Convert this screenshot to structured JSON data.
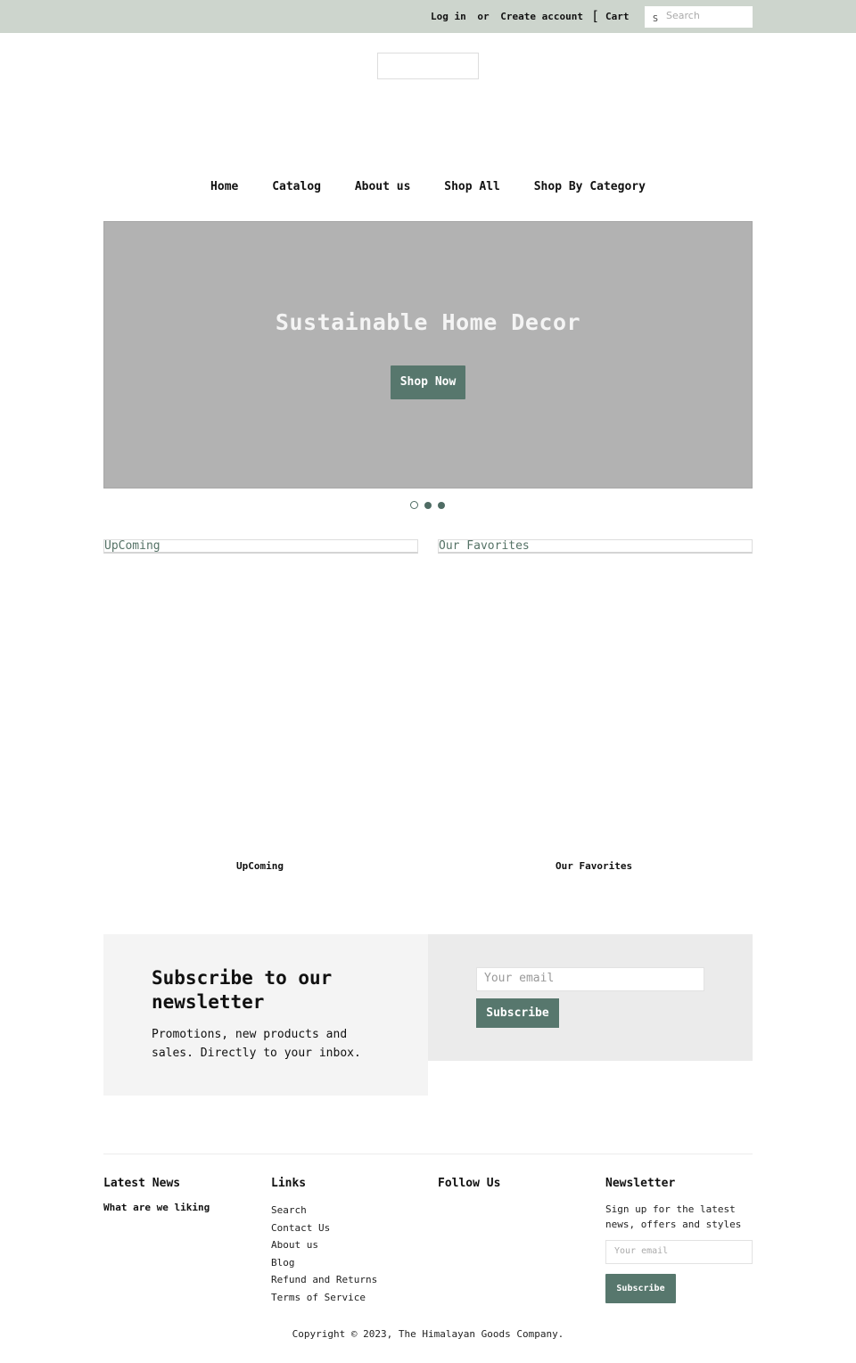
{
  "topbar": {
    "login": "Log in",
    "or": "or",
    "create_account": "Create account",
    "cart_icon": "[",
    "cart": "Cart",
    "search_icon": "S",
    "search_placeholder": "Search"
  },
  "nav": {
    "items": [
      "Home",
      "Catalog",
      "About us",
      "Shop All",
      "Shop By Category"
    ]
  },
  "hero": {
    "title": "Sustainable Home Decor",
    "button": "Shop Now",
    "slide_count": 3,
    "active_slide": 1
  },
  "collections": {
    "headings": [
      "UpComing",
      "Our Favorites"
    ],
    "labels": [
      "UpComing",
      "Our Favorites"
    ]
  },
  "newsletter": {
    "title": "Subscribe to our newsletter",
    "text": "Promotions, new products and sales. Directly to your inbox.",
    "email_placeholder": "Your email",
    "button": "Subscribe"
  },
  "footer": {
    "latest_news": {
      "heading": "Latest News",
      "item": "What are we liking"
    },
    "links": {
      "heading": "Links",
      "items": [
        "Search",
        "Contact Us",
        "About us",
        "Blog",
        "Refund and Returns",
        "Terms of Service"
      ]
    },
    "follow": {
      "heading": "Follow Us"
    },
    "newsletter": {
      "heading": "Newsletter",
      "text": "Sign up for the latest news, offers and styles",
      "email_placeholder": "Your email",
      "button": "Subscribe"
    },
    "copyright": "Copyright © 2023, The Himalayan Goods Company."
  },
  "colors": {
    "topbar_bg": "#cdd5cd",
    "accent": "#57776d",
    "hero_bg": "#b2b2b2"
  }
}
